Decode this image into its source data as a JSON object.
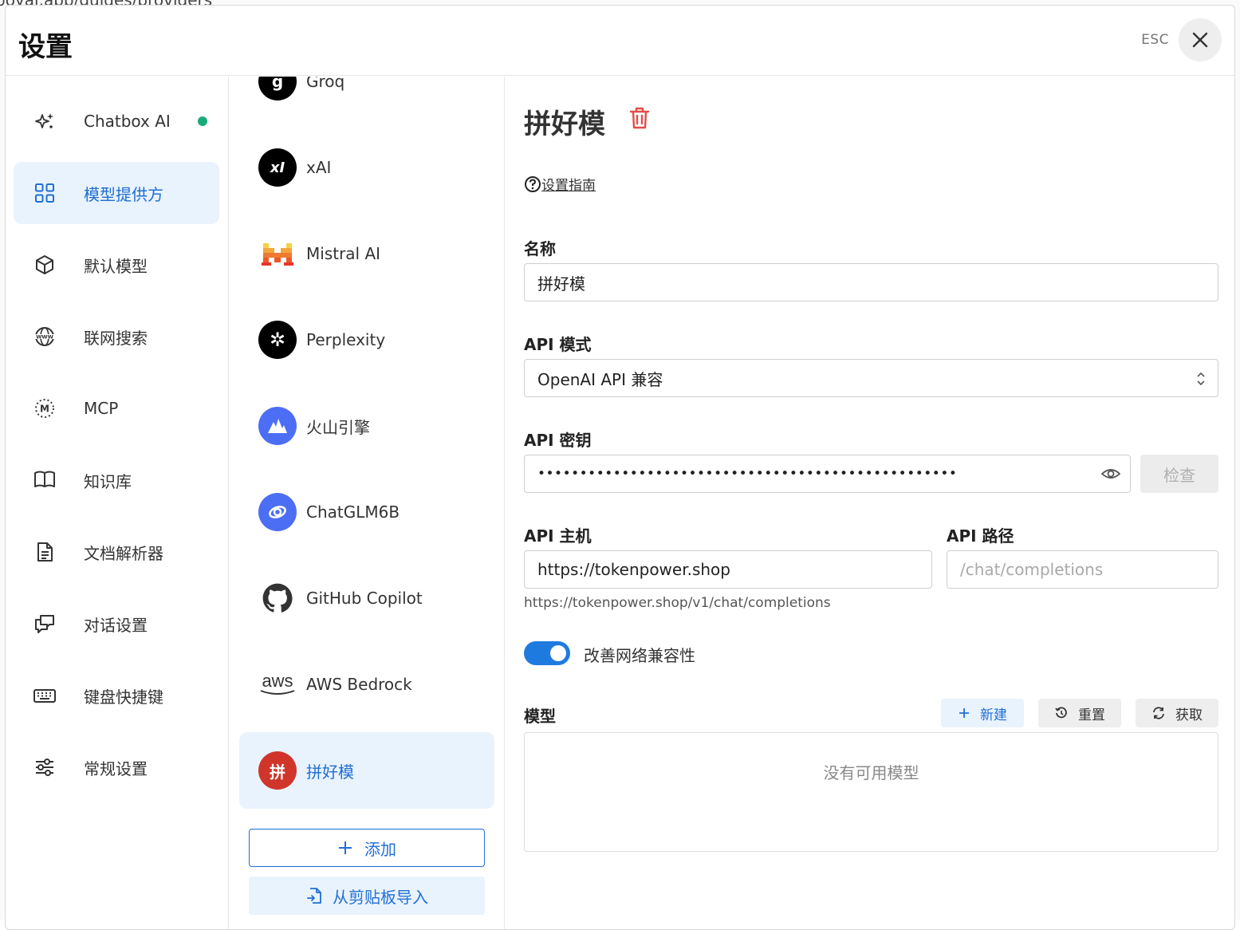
{
  "background": {
    "url_fragment": "boyai.app/guides/providers"
  },
  "header": {
    "title": "设置",
    "esc_label": "ESC"
  },
  "nav": {
    "items": [
      {
        "label": "Chatbox AI",
        "icon": "sparkle-icon",
        "status_dot": true
      },
      {
        "label": "模型提供方",
        "icon": "grid-icon",
        "active": true
      },
      {
        "label": "默认模型",
        "icon": "cube-icon"
      },
      {
        "label": "联网搜索",
        "icon": "www-globe-icon"
      },
      {
        "label": "MCP",
        "icon": "mcp-icon"
      },
      {
        "label": "知识库",
        "icon": "book-icon"
      },
      {
        "label": "文档解析器",
        "icon": "document-icon"
      },
      {
        "label": "对话设置",
        "icon": "chat-icon"
      },
      {
        "label": "键盘快捷键",
        "icon": "keyboard-icon"
      },
      {
        "label": "常规设置",
        "icon": "sliders-icon"
      }
    ]
  },
  "providers": {
    "items": [
      {
        "name": "Groq",
        "logo_text": "g",
        "color": "#000000"
      },
      {
        "name": "xAI",
        "logo_text": "xI",
        "color": "#000000"
      },
      {
        "name": "Mistral AI",
        "logo_text": "M",
        "color": "#ffffff"
      },
      {
        "name": "Perplexity",
        "logo_text": "✲",
        "color": "#000000"
      },
      {
        "name": "火山引擎",
        "logo_text": "▲",
        "color": "#4c6ef5"
      },
      {
        "name": "ChatGLM6B",
        "logo_text": "◎",
        "color": "#4c6ef5"
      },
      {
        "name": "GitHub Copilot",
        "logo_text": "",
        "color": "#ffffff"
      },
      {
        "name": "AWS Bedrock",
        "logo_text": "aws",
        "color": "#ffffff"
      },
      {
        "name": "拼好模",
        "logo_text": "拼",
        "color": "#d0352b",
        "active": true
      }
    ],
    "add_label": "添加",
    "import_label": "从剪贴板导入"
  },
  "detail": {
    "title": "拼好模",
    "guide_label": "设置指南",
    "name_label": "名称",
    "name_value": "拼好模",
    "api_mode_label": "API 模式",
    "api_mode_value": "OpenAI API 兼容",
    "api_key_label": "API 密钥",
    "api_key_value": "••••••••••••••••••••••••••••••••••••••••••••••••••",
    "check_label": "检查",
    "api_host_label": "API 主机",
    "api_host_value": "https://tokenpower.shop",
    "api_path_label": "API 路径",
    "api_path_placeholder": "/chat/completions",
    "resolved_url": "https://tokenpower.shop/v1/chat/completions",
    "toggle_label": "改善网络兼容性",
    "toggle_on": true,
    "models_label": "模型",
    "new_label": "新建",
    "reset_label": "重置",
    "fetch_label": "获取",
    "empty_label": "没有可用模型"
  },
  "colors": {
    "accent": "#1f6ed4",
    "active_bg": "#e9f3fd",
    "danger": "#e24c4b",
    "status_green": "#1aaa7a"
  }
}
